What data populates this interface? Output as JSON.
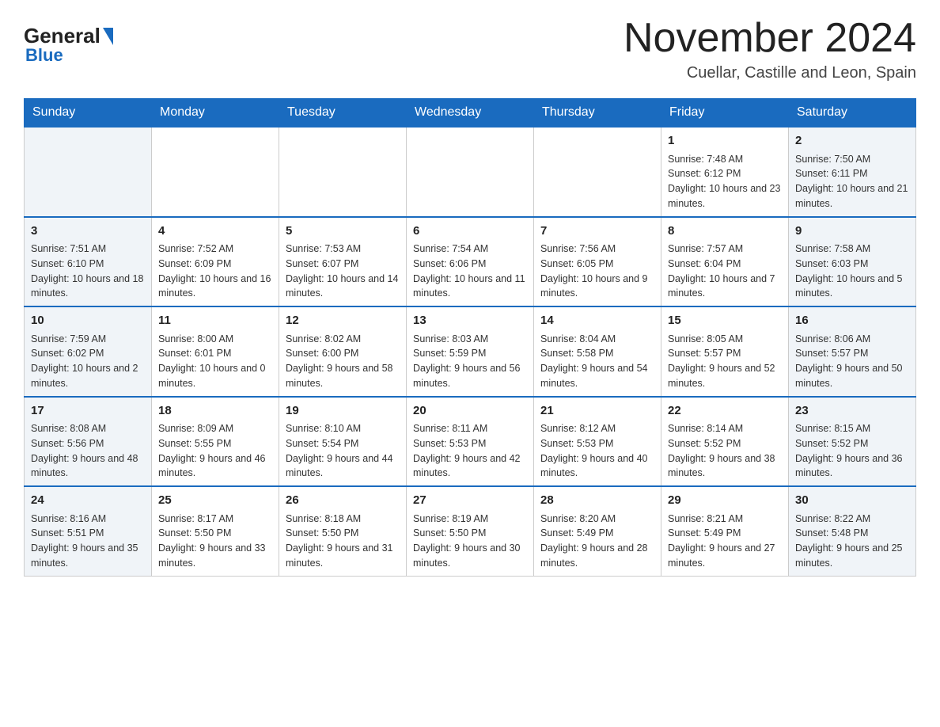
{
  "header": {
    "logo": {
      "general": "General",
      "blue": "Blue"
    },
    "title": "November 2024",
    "subtitle": "Cuellar, Castille and Leon, Spain"
  },
  "calendar": {
    "weekdays": [
      "Sunday",
      "Monday",
      "Tuesday",
      "Wednesday",
      "Thursday",
      "Friday",
      "Saturday"
    ],
    "weeks": [
      [
        {
          "day": "",
          "sunrise": "",
          "sunset": "",
          "daylight": ""
        },
        {
          "day": "",
          "sunrise": "",
          "sunset": "",
          "daylight": ""
        },
        {
          "day": "",
          "sunrise": "",
          "sunset": "",
          "daylight": ""
        },
        {
          "day": "",
          "sunrise": "",
          "sunset": "",
          "daylight": ""
        },
        {
          "day": "",
          "sunrise": "",
          "sunset": "",
          "daylight": ""
        },
        {
          "day": "1",
          "sunrise": "Sunrise: 7:48 AM",
          "sunset": "Sunset: 6:12 PM",
          "daylight": "Daylight: 10 hours and 23 minutes."
        },
        {
          "day": "2",
          "sunrise": "Sunrise: 7:50 AM",
          "sunset": "Sunset: 6:11 PM",
          "daylight": "Daylight: 10 hours and 21 minutes."
        }
      ],
      [
        {
          "day": "3",
          "sunrise": "Sunrise: 7:51 AM",
          "sunset": "Sunset: 6:10 PM",
          "daylight": "Daylight: 10 hours and 18 minutes."
        },
        {
          "day": "4",
          "sunrise": "Sunrise: 7:52 AM",
          "sunset": "Sunset: 6:09 PM",
          "daylight": "Daylight: 10 hours and 16 minutes."
        },
        {
          "day": "5",
          "sunrise": "Sunrise: 7:53 AM",
          "sunset": "Sunset: 6:07 PM",
          "daylight": "Daylight: 10 hours and 14 minutes."
        },
        {
          "day": "6",
          "sunrise": "Sunrise: 7:54 AM",
          "sunset": "Sunset: 6:06 PM",
          "daylight": "Daylight: 10 hours and 11 minutes."
        },
        {
          "day": "7",
          "sunrise": "Sunrise: 7:56 AM",
          "sunset": "Sunset: 6:05 PM",
          "daylight": "Daylight: 10 hours and 9 minutes."
        },
        {
          "day": "8",
          "sunrise": "Sunrise: 7:57 AM",
          "sunset": "Sunset: 6:04 PM",
          "daylight": "Daylight: 10 hours and 7 minutes."
        },
        {
          "day": "9",
          "sunrise": "Sunrise: 7:58 AM",
          "sunset": "Sunset: 6:03 PM",
          "daylight": "Daylight: 10 hours and 5 minutes."
        }
      ],
      [
        {
          "day": "10",
          "sunrise": "Sunrise: 7:59 AM",
          "sunset": "Sunset: 6:02 PM",
          "daylight": "Daylight: 10 hours and 2 minutes."
        },
        {
          "day": "11",
          "sunrise": "Sunrise: 8:00 AM",
          "sunset": "Sunset: 6:01 PM",
          "daylight": "Daylight: 10 hours and 0 minutes."
        },
        {
          "day": "12",
          "sunrise": "Sunrise: 8:02 AM",
          "sunset": "Sunset: 6:00 PM",
          "daylight": "Daylight: 9 hours and 58 minutes."
        },
        {
          "day": "13",
          "sunrise": "Sunrise: 8:03 AM",
          "sunset": "Sunset: 5:59 PM",
          "daylight": "Daylight: 9 hours and 56 minutes."
        },
        {
          "day": "14",
          "sunrise": "Sunrise: 8:04 AM",
          "sunset": "Sunset: 5:58 PM",
          "daylight": "Daylight: 9 hours and 54 minutes."
        },
        {
          "day": "15",
          "sunrise": "Sunrise: 8:05 AM",
          "sunset": "Sunset: 5:57 PM",
          "daylight": "Daylight: 9 hours and 52 minutes."
        },
        {
          "day": "16",
          "sunrise": "Sunrise: 8:06 AM",
          "sunset": "Sunset: 5:57 PM",
          "daylight": "Daylight: 9 hours and 50 minutes."
        }
      ],
      [
        {
          "day": "17",
          "sunrise": "Sunrise: 8:08 AM",
          "sunset": "Sunset: 5:56 PM",
          "daylight": "Daylight: 9 hours and 48 minutes."
        },
        {
          "day": "18",
          "sunrise": "Sunrise: 8:09 AM",
          "sunset": "Sunset: 5:55 PM",
          "daylight": "Daylight: 9 hours and 46 minutes."
        },
        {
          "day": "19",
          "sunrise": "Sunrise: 8:10 AM",
          "sunset": "Sunset: 5:54 PM",
          "daylight": "Daylight: 9 hours and 44 minutes."
        },
        {
          "day": "20",
          "sunrise": "Sunrise: 8:11 AM",
          "sunset": "Sunset: 5:53 PM",
          "daylight": "Daylight: 9 hours and 42 minutes."
        },
        {
          "day": "21",
          "sunrise": "Sunrise: 8:12 AM",
          "sunset": "Sunset: 5:53 PM",
          "daylight": "Daylight: 9 hours and 40 minutes."
        },
        {
          "day": "22",
          "sunrise": "Sunrise: 8:14 AM",
          "sunset": "Sunset: 5:52 PM",
          "daylight": "Daylight: 9 hours and 38 minutes."
        },
        {
          "day": "23",
          "sunrise": "Sunrise: 8:15 AM",
          "sunset": "Sunset: 5:52 PM",
          "daylight": "Daylight: 9 hours and 36 minutes."
        }
      ],
      [
        {
          "day": "24",
          "sunrise": "Sunrise: 8:16 AM",
          "sunset": "Sunset: 5:51 PM",
          "daylight": "Daylight: 9 hours and 35 minutes."
        },
        {
          "day": "25",
          "sunrise": "Sunrise: 8:17 AM",
          "sunset": "Sunset: 5:50 PM",
          "daylight": "Daylight: 9 hours and 33 minutes."
        },
        {
          "day": "26",
          "sunrise": "Sunrise: 8:18 AM",
          "sunset": "Sunset: 5:50 PM",
          "daylight": "Daylight: 9 hours and 31 minutes."
        },
        {
          "day": "27",
          "sunrise": "Sunrise: 8:19 AM",
          "sunset": "Sunset: 5:50 PM",
          "daylight": "Daylight: 9 hours and 30 minutes."
        },
        {
          "day": "28",
          "sunrise": "Sunrise: 8:20 AM",
          "sunset": "Sunset: 5:49 PM",
          "daylight": "Daylight: 9 hours and 28 minutes."
        },
        {
          "day": "29",
          "sunrise": "Sunrise: 8:21 AM",
          "sunset": "Sunset: 5:49 PM",
          "daylight": "Daylight: 9 hours and 27 minutes."
        },
        {
          "day": "30",
          "sunrise": "Sunrise: 8:22 AM",
          "sunset": "Sunset: 5:48 PM",
          "daylight": "Daylight: 9 hours and 25 minutes."
        }
      ]
    ]
  }
}
